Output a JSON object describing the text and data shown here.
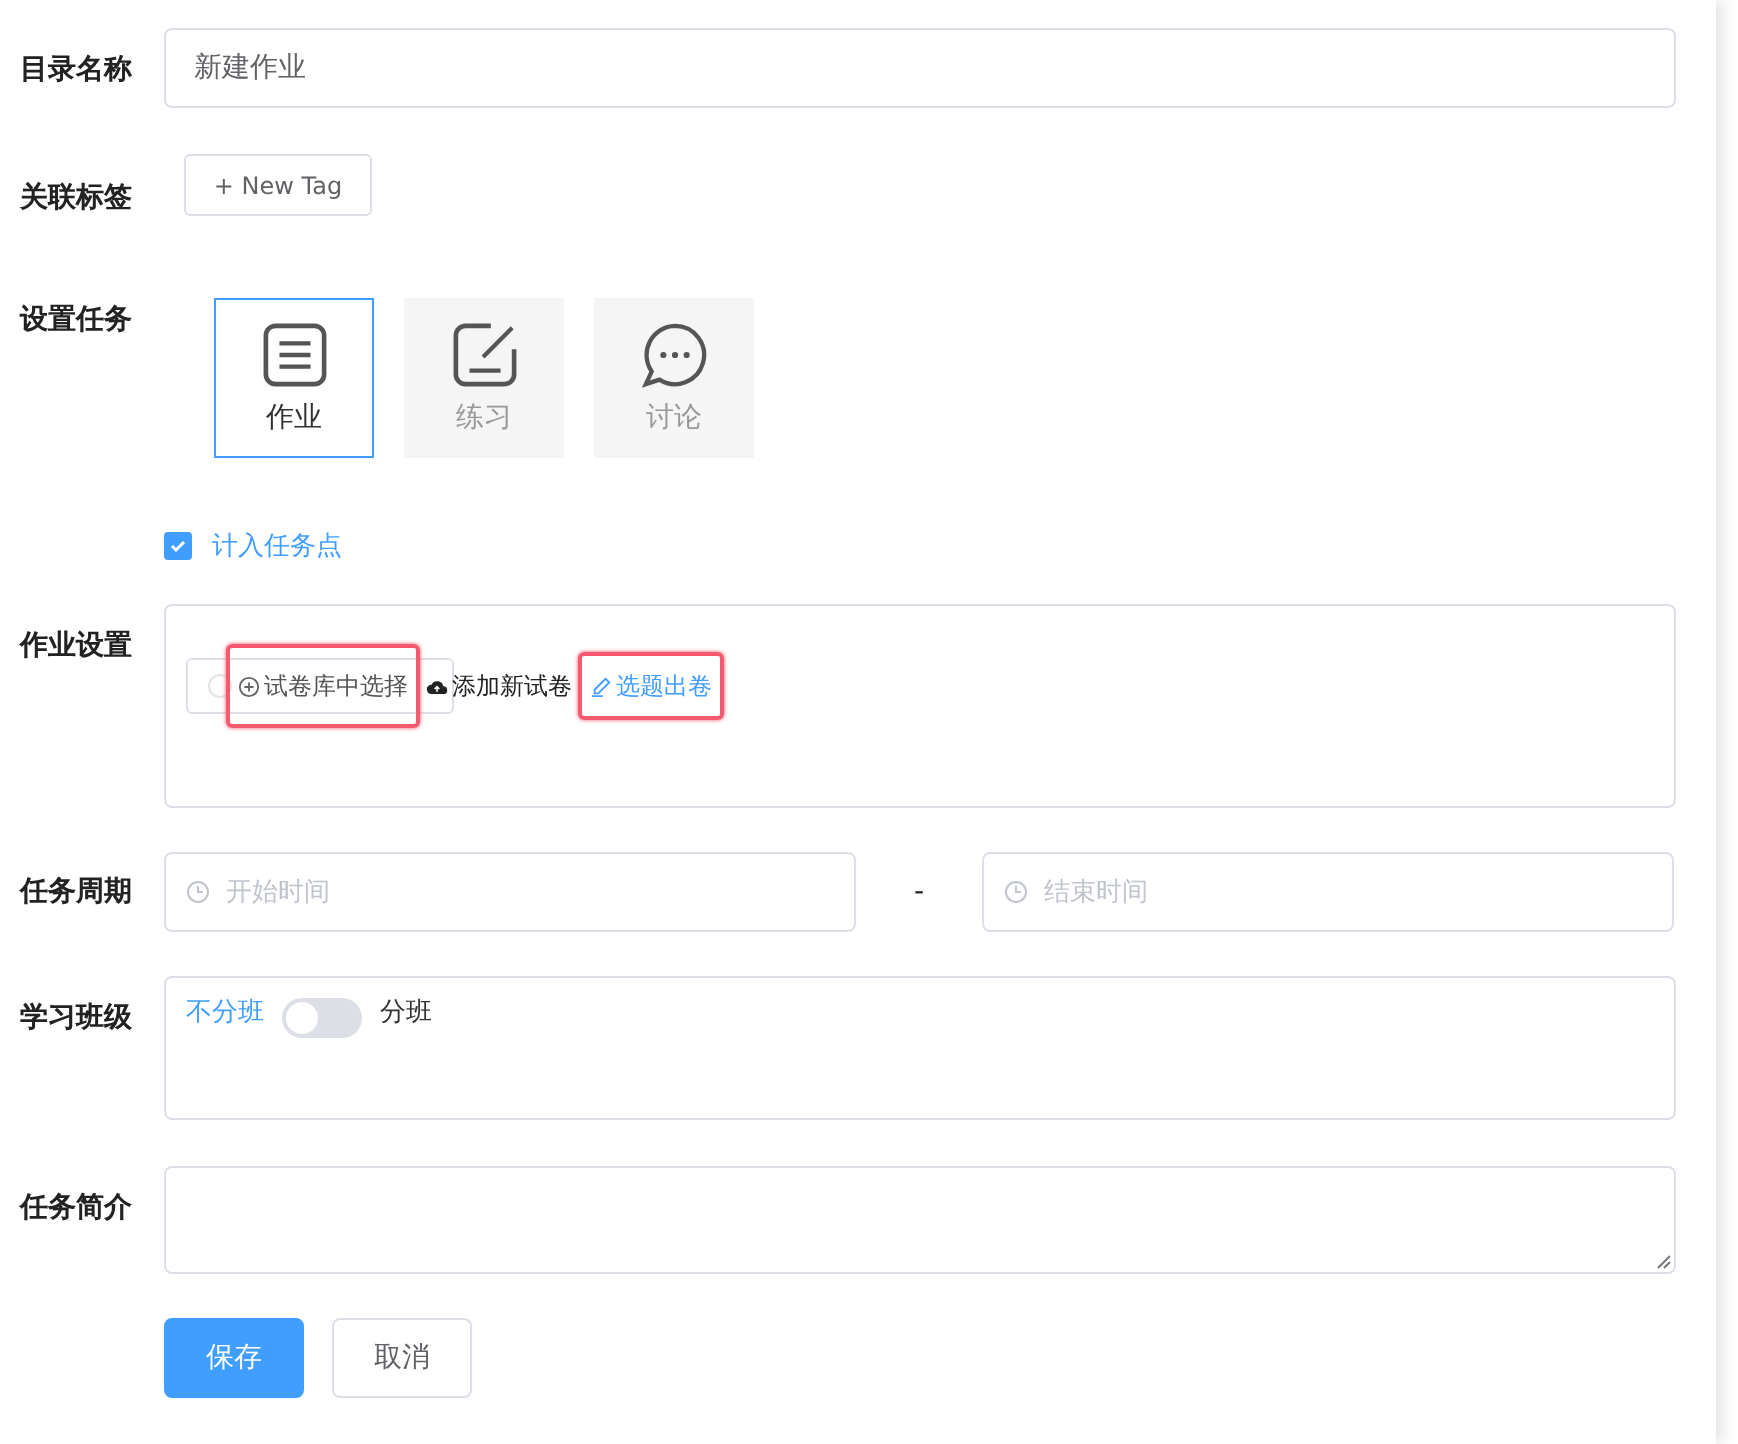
{
  "rows": [
    {
      "kind": "input",
      "label": "目录名称",
      "value": "新建作业"
    },
    {
      "kind": "tags",
      "label": "关联标签",
      "button": "+ New Tag"
    },
    {
      "kind": "tasks",
      "label": "设置任务",
      "tiles": [
        {
          "kind": "list",
          "text": "作业",
          "selected": true
        },
        {
          "kind": "edit",
          "text": "练习",
          "selected": false
        },
        {
          "kind": "chat",
          "text": "讨论",
          "selected": false
        }
      ]
    },
    {
      "kind": "checkbox",
      "text": "计入任务点",
      "checked": true
    },
    {
      "kind": "homework",
      "label": "作业设置",
      "actions": [
        {
          "kind": "select",
          "text": "试卷库中选择",
          "highlighted": true
        },
        {
          "kind": "upload",
          "text": "添加新试卷",
          "highlighted": false
        },
        {
          "kind": "link",
          "text": "选题出卷",
          "highlighted": true
        }
      ]
    },
    {
      "kind": "range",
      "label": "任务周期",
      "start_placeholder": "开始时间",
      "separator": "-",
      "end_placeholder": "结束时间"
    },
    {
      "kind": "switch",
      "label": "学习班级",
      "off_text": "不分班",
      "on_text": "分班",
      "on": false
    },
    {
      "kind": "textarea",
      "label": "任务简介"
    },
    {
      "kind": "buttons",
      "buttons": [
        {
          "text": "保存",
          "primary": true
        },
        {
          "text": "取消",
          "primary": false
        }
      ]
    }
  ]
}
